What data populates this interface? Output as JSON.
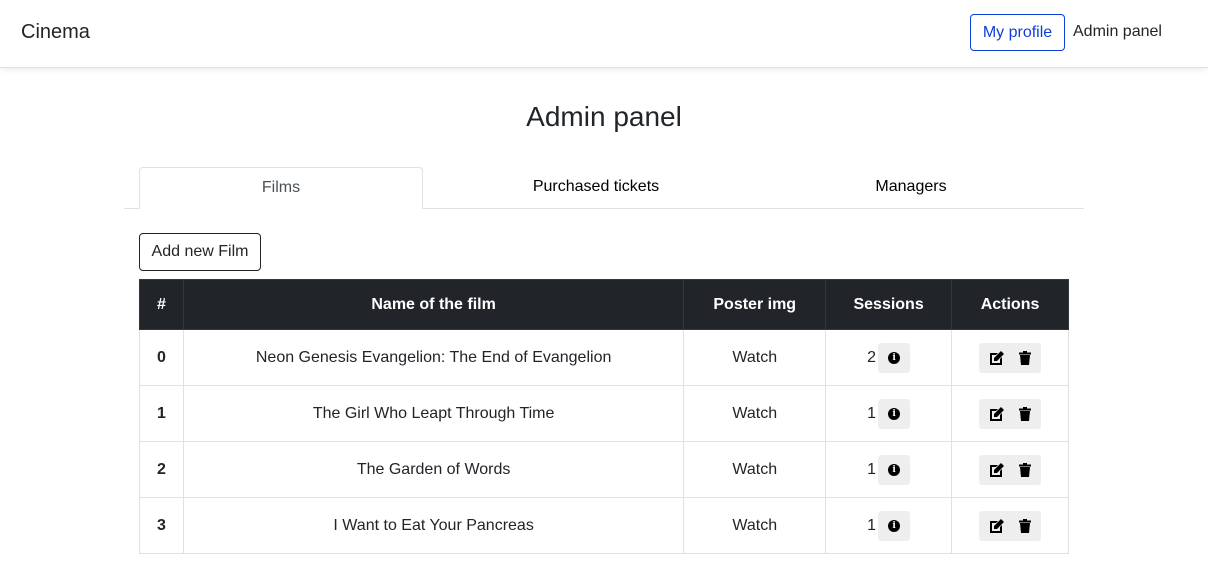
{
  "navbar": {
    "brand": "Cinema",
    "profile_label": "My profile",
    "admin_label": "Admin panel"
  },
  "page": {
    "title": "Admin panel"
  },
  "tabs": [
    {
      "label": "Films",
      "active": true
    },
    {
      "label": "Purchased tickets",
      "active": false
    },
    {
      "label": "Managers",
      "active": false
    }
  ],
  "add_button_label": "Add new Film",
  "table": {
    "headers": [
      "#",
      "Name of the film",
      "Poster img",
      "Sessions",
      "Actions"
    ],
    "rows": [
      {
        "index": "0",
        "name": "Neon Genesis Evangelion: The End of Evangelion",
        "poster": "Watch",
        "sessions": "2"
      },
      {
        "index": "1",
        "name": "The Girl Who Leapt Through Time",
        "poster": "Watch",
        "sessions": "1"
      },
      {
        "index": "2",
        "name": "The Garden of Words",
        "poster": "Watch",
        "sessions": "1"
      },
      {
        "index": "3",
        "name": "I Want to Eat Your Pancreas",
        "poster": "Watch",
        "sessions": "1"
      }
    ]
  },
  "icons": {
    "info": "info-icon",
    "edit": "edit-icon",
    "delete": "trash-icon"
  },
  "colors": {
    "accent": "#0d3fd6",
    "table_header_bg": "#212529",
    "icon_button_bg": "#eeeeee"
  }
}
